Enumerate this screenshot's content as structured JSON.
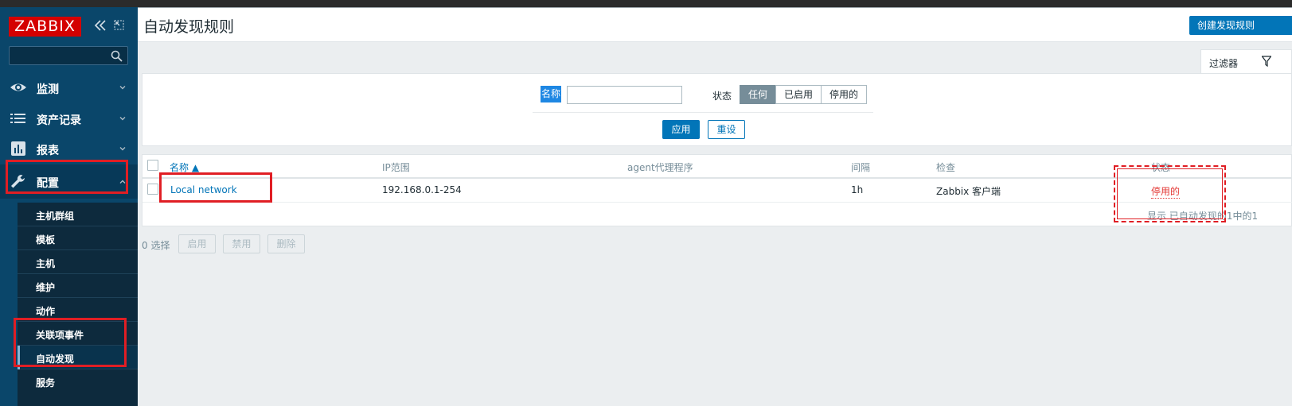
{
  "sidebar": {
    "logo": "ZABBIX",
    "search_placeholder": "",
    "menu": [
      {
        "label": "监测",
        "icon": "eye-icon"
      },
      {
        "label": "资产记录",
        "icon": "list-icon"
      },
      {
        "label": "报表",
        "icon": "bar-chart-icon"
      },
      {
        "label": "配置",
        "icon": "wrench-icon"
      }
    ],
    "submenu": [
      "主机群组",
      "模板",
      "主机",
      "维护",
      "动作",
      "关联项事件",
      "自动发现",
      "服务"
    ]
  },
  "header": {
    "title": "自动发现规则",
    "create_button": "创建发现规则"
  },
  "filter": {
    "tab_label": "过滤器",
    "name_label": "名称",
    "name_value": "",
    "status_label": "状态",
    "status_options": [
      "任何",
      "已启用",
      "停用的"
    ],
    "status_selected": "任何",
    "apply": "应用",
    "reset": "重设"
  },
  "table": {
    "columns": [
      "名称 ▲",
      "IP范围",
      "agent代理程序",
      "间隔",
      "检查",
      "状态"
    ],
    "rows": [
      {
        "name": "Local network",
        "ip_range": "192.168.0.1-254",
        "proxy": "",
        "interval": "1h",
        "checks": "Zabbix 客户端",
        "status": "停用的"
      }
    ],
    "footer": "显示 已自动发现的1中的1"
  },
  "mass_actions": {
    "selected": "0 选择",
    "enable": "启用",
    "disable": "禁用",
    "delete": "删除"
  },
  "colors": {
    "sidebar_bg": "#0a466a",
    "accent": "#0275b8",
    "logo_red": "#d40000",
    "status_disabled": "#e33734",
    "annotation": "#e01e24"
  }
}
